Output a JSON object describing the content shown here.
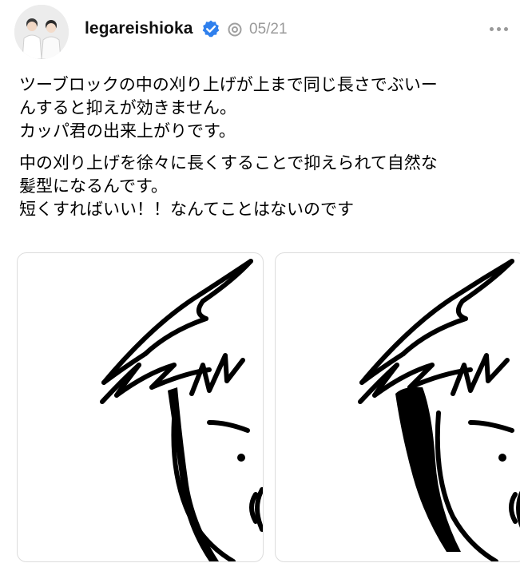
{
  "header": {
    "username": "legareishioka",
    "timestamp": "05/21"
  },
  "icons": {
    "avatar": "avatar",
    "verified": "verified-badge-icon",
    "thread": "thread-icon",
    "more": "more-options-icon"
  },
  "colors": {
    "verified": "#2f80ed",
    "muted": "#9a9a9a"
  },
  "post": {
    "paragraphs": [
      {
        "lines": [
          "ツーブロックの中の刈り上げが上まで同じ長さでぶいー",
          "んすると抑えが効きません。",
          "カッパ君の出来上がりです。"
        ]
      },
      {
        "lines": [
          "中の刈り上げを徐々に長くすることで抑えられて自然な",
          "髪型になるんです。",
          "短くすればいい！！なんてことはないのです"
        ]
      }
    ]
  }
}
